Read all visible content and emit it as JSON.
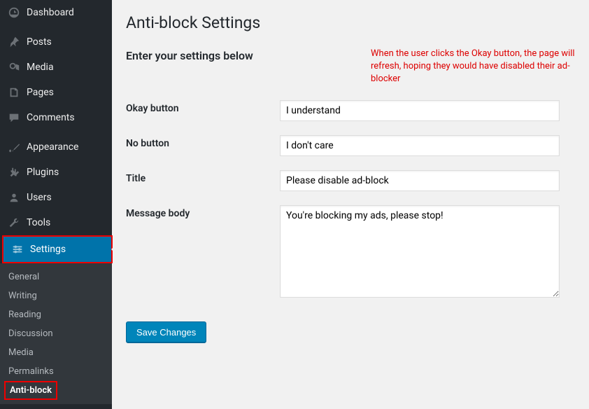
{
  "sidebar": {
    "items": [
      {
        "label": "Dashboard"
      },
      {
        "label": "Posts"
      },
      {
        "label": "Media"
      },
      {
        "label": "Pages"
      },
      {
        "label": "Comments"
      },
      {
        "label": "Appearance"
      },
      {
        "label": "Plugins"
      },
      {
        "label": "Users"
      },
      {
        "label": "Tools"
      },
      {
        "label": "Settings"
      }
    ],
    "submenu": [
      {
        "label": "General"
      },
      {
        "label": "Writing"
      },
      {
        "label": "Reading"
      },
      {
        "label": "Discussion"
      },
      {
        "label": "Media"
      },
      {
        "label": "Permalinks"
      },
      {
        "label": "Anti-block"
      }
    ]
  },
  "page": {
    "title": "Anti-block Settings",
    "subtitle": "Enter your settings below",
    "note": "When the user clicks the Okay button, the page will refresh, hoping they would have disabled their ad-blocker"
  },
  "form": {
    "okay_label": "Okay button",
    "okay_value": "I understand",
    "no_label": "No button",
    "no_value": "I don't care",
    "title_label": "Title",
    "title_value": "Please disable ad-block",
    "msg_label": "Message body",
    "msg_value": "You're blocking my ads, please stop!",
    "save": "Save Changes"
  }
}
